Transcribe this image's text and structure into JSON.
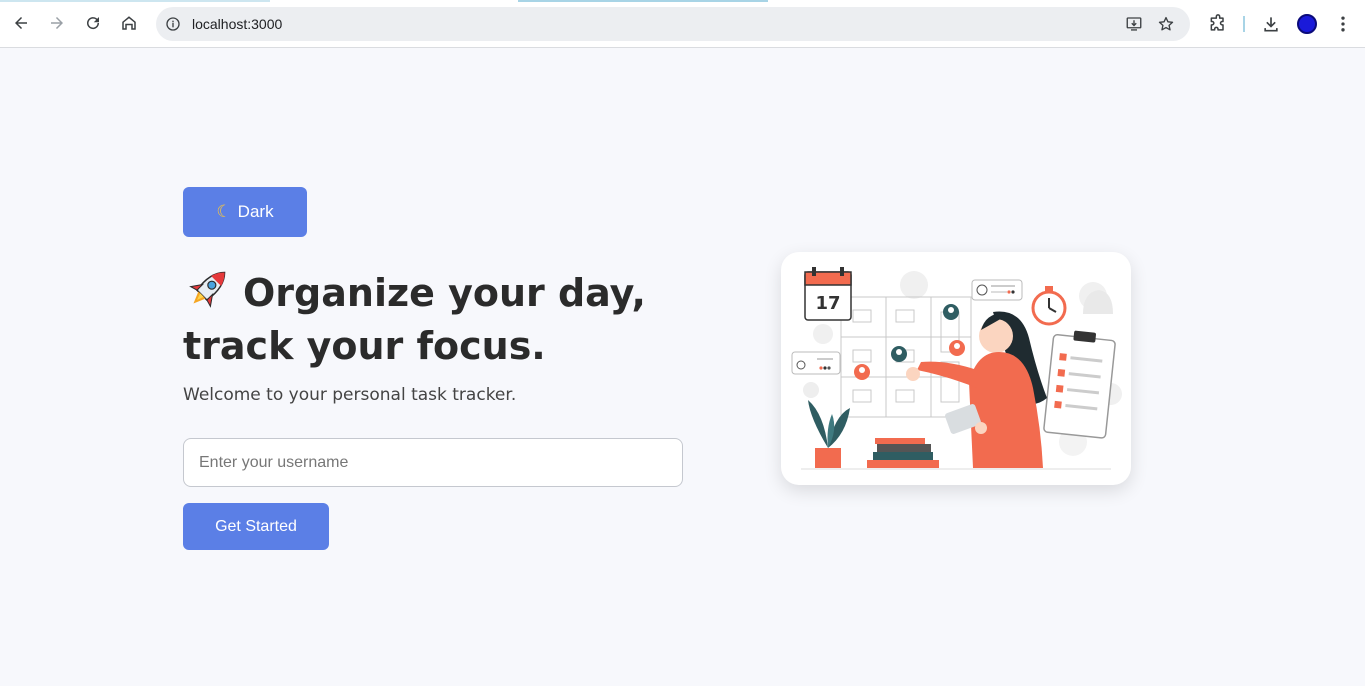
{
  "browser": {
    "url": "localhost:3000",
    "icons": [
      "back-icon",
      "forward-icon",
      "reload-icon",
      "home-icon",
      "site-info-icon",
      "install-app-icon",
      "bookmark-star-icon",
      "extensions-icon",
      "download-icon",
      "profile-avatar",
      "more-menu-icon"
    ]
  },
  "page": {
    "theme_toggle_label": "Dark",
    "headline_line1": "Organize your day,",
    "headline_line2": "track your focus.",
    "subtitle": "Welcome to your personal task tracker.",
    "username_placeholder": "Enter your username",
    "username_value": "",
    "get_started_label": "Get Started",
    "illustration_calendar_day": "17"
  },
  "colors": {
    "accent": "#5b7fe6",
    "background": "#f7f8fc",
    "illustration_coral": "#f26b4f",
    "illustration_teal": "#2f5d62"
  }
}
